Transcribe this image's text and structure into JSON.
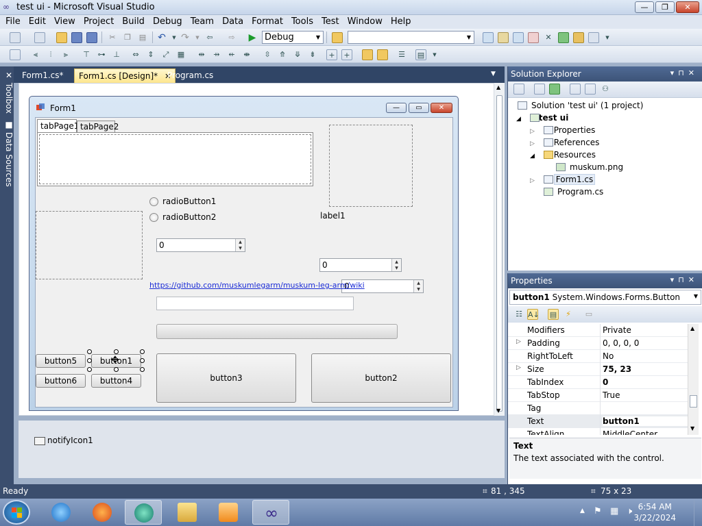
{
  "window": {
    "title": "test ui - Microsoft Visual Studio"
  },
  "menu": [
    "File",
    "Edit",
    "View",
    "Project",
    "Build",
    "Debug",
    "Team",
    "Data",
    "Format",
    "Tools",
    "Test",
    "Window",
    "Help"
  ],
  "toolbar": {
    "config_value": "Debug",
    "platform_value": ""
  },
  "side_tabs": [
    "Toolbox",
    "Data Sources"
  ],
  "doc_tabs": [
    {
      "label": "Form1.cs*",
      "active": false
    },
    {
      "label": "Form1.cs [Design]*",
      "active": true
    },
    {
      "label": "Program.cs",
      "active": false
    }
  ],
  "form": {
    "title": "Form1",
    "tabs": [
      "tabPage1",
      "tabPage2"
    ],
    "radio1": "radioButton1",
    "radio2": "radioButton2",
    "label1": "label1",
    "numeric1": "0",
    "numeric2": "0",
    "numeric3": "0",
    "link": "https://github.com/muskumlegarm/muskum-leg-arm/wiki",
    "buttons": {
      "button1": "button1",
      "button2": "button2",
      "button3": "button3",
      "button4": "button4",
      "button5": "button5",
      "button6": "button6"
    }
  },
  "tray": {
    "notify": "notifyIcon1"
  },
  "solution_explorer": {
    "title": "Solution Explorer",
    "items": [
      {
        "label": "Solution 'test ui' (1 project)"
      },
      {
        "label": "test ui"
      },
      {
        "label": "Properties"
      },
      {
        "label": "References"
      },
      {
        "label": "Resources"
      },
      {
        "label": "muskum.png"
      },
      {
        "label": "Form1.cs"
      },
      {
        "label": "Program.cs"
      }
    ]
  },
  "properties": {
    "title": "Properties",
    "object_name": "button1",
    "object_type": "System.Windows.Forms.Button",
    "rows": [
      {
        "name": "Modifiers",
        "value": "Private",
        "expand": false
      },
      {
        "name": "Padding",
        "value": "0, 0, 0, 0",
        "expand": true
      },
      {
        "name": "RightToLeft",
        "value": "No",
        "expand": false
      },
      {
        "name": "Size",
        "value": "75, 23",
        "expand": true
      },
      {
        "name": "TabIndex",
        "value": "0",
        "expand": false
      },
      {
        "name": "TabStop",
        "value": "True",
        "expand": false
      },
      {
        "name": "Tag",
        "value": "",
        "expand": false
      },
      {
        "name": "Text",
        "value": "button1",
        "expand": false
      },
      {
        "name": "TextAlign",
        "value": "MiddleCenter",
        "expand": false
      }
    ],
    "desc_title": "Text",
    "desc_text": "The text associated with the control."
  },
  "status": {
    "text": "Ready",
    "position": "81 , 345",
    "size": "75 x 23"
  },
  "clock": {
    "time": "6:54 AM",
    "date": "3/22/2024"
  }
}
